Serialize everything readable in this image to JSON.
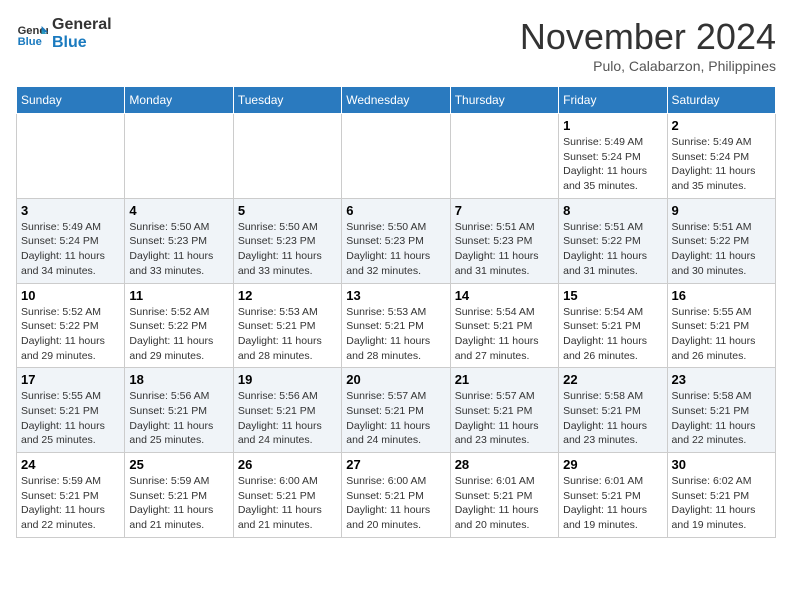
{
  "header": {
    "logo_line1": "General",
    "logo_line2": "Blue",
    "month": "November 2024",
    "location": "Pulo, Calabarzon, Philippines"
  },
  "weekdays": [
    "Sunday",
    "Monday",
    "Tuesday",
    "Wednesday",
    "Thursday",
    "Friday",
    "Saturday"
  ],
  "weeks": [
    [
      {
        "day": "",
        "info": ""
      },
      {
        "day": "",
        "info": ""
      },
      {
        "day": "",
        "info": ""
      },
      {
        "day": "",
        "info": ""
      },
      {
        "day": "",
        "info": ""
      },
      {
        "day": "1",
        "info": "Sunrise: 5:49 AM\nSunset: 5:24 PM\nDaylight: 11 hours and 35 minutes."
      },
      {
        "day": "2",
        "info": "Sunrise: 5:49 AM\nSunset: 5:24 PM\nDaylight: 11 hours and 35 minutes."
      }
    ],
    [
      {
        "day": "3",
        "info": "Sunrise: 5:49 AM\nSunset: 5:24 PM\nDaylight: 11 hours and 34 minutes."
      },
      {
        "day": "4",
        "info": "Sunrise: 5:50 AM\nSunset: 5:23 PM\nDaylight: 11 hours and 33 minutes."
      },
      {
        "day": "5",
        "info": "Sunrise: 5:50 AM\nSunset: 5:23 PM\nDaylight: 11 hours and 33 minutes."
      },
      {
        "day": "6",
        "info": "Sunrise: 5:50 AM\nSunset: 5:23 PM\nDaylight: 11 hours and 32 minutes."
      },
      {
        "day": "7",
        "info": "Sunrise: 5:51 AM\nSunset: 5:23 PM\nDaylight: 11 hours and 31 minutes."
      },
      {
        "day": "8",
        "info": "Sunrise: 5:51 AM\nSunset: 5:22 PM\nDaylight: 11 hours and 31 minutes."
      },
      {
        "day": "9",
        "info": "Sunrise: 5:51 AM\nSunset: 5:22 PM\nDaylight: 11 hours and 30 minutes."
      }
    ],
    [
      {
        "day": "10",
        "info": "Sunrise: 5:52 AM\nSunset: 5:22 PM\nDaylight: 11 hours and 29 minutes."
      },
      {
        "day": "11",
        "info": "Sunrise: 5:52 AM\nSunset: 5:22 PM\nDaylight: 11 hours and 29 minutes."
      },
      {
        "day": "12",
        "info": "Sunrise: 5:53 AM\nSunset: 5:21 PM\nDaylight: 11 hours and 28 minutes."
      },
      {
        "day": "13",
        "info": "Sunrise: 5:53 AM\nSunset: 5:21 PM\nDaylight: 11 hours and 28 minutes."
      },
      {
        "day": "14",
        "info": "Sunrise: 5:54 AM\nSunset: 5:21 PM\nDaylight: 11 hours and 27 minutes."
      },
      {
        "day": "15",
        "info": "Sunrise: 5:54 AM\nSunset: 5:21 PM\nDaylight: 11 hours and 26 minutes."
      },
      {
        "day": "16",
        "info": "Sunrise: 5:55 AM\nSunset: 5:21 PM\nDaylight: 11 hours and 26 minutes."
      }
    ],
    [
      {
        "day": "17",
        "info": "Sunrise: 5:55 AM\nSunset: 5:21 PM\nDaylight: 11 hours and 25 minutes."
      },
      {
        "day": "18",
        "info": "Sunrise: 5:56 AM\nSunset: 5:21 PM\nDaylight: 11 hours and 25 minutes."
      },
      {
        "day": "19",
        "info": "Sunrise: 5:56 AM\nSunset: 5:21 PM\nDaylight: 11 hours and 24 minutes."
      },
      {
        "day": "20",
        "info": "Sunrise: 5:57 AM\nSunset: 5:21 PM\nDaylight: 11 hours and 24 minutes."
      },
      {
        "day": "21",
        "info": "Sunrise: 5:57 AM\nSunset: 5:21 PM\nDaylight: 11 hours and 23 minutes."
      },
      {
        "day": "22",
        "info": "Sunrise: 5:58 AM\nSunset: 5:21 PM\nDaylight: 11 hours and 23 minutes."
      },
      {
        "day": "23",
        "info": "Sunrise: 5:58 AM\nSunset: 5:21 PM\nDaylight: 11 hours and 22 minutes."
      }
    ],
    [
      {
        "day": "24",
        "info": "Sunrise: 5:59 AM\nSunset: 5:21 PM\nDaylight: 11 hours and 22 minutes."
      },
      {
        "day": "25",
        "info": "Sunrise: 5:59 AM\nSunset: 5:21 PM\nDaylight: 11 hours and 21 minutes."
      },
      {
        "day": "26",
        "info": "Sunrise: 6:00 AM\nSunset: 5:21 PM\nDaylight: 11 hours and 21 minutes."
      },
      {
        "day": "27",
        "info": "Sunrise: 6:00 AM\nSunset: 5:21 PM\nDaylight: 11 hours and 20 minutes."
      },
      {
        "day": "28",
        "info": "Sunrise: 6:01 AM\nSunset: 5:21 PM\nDaylight: 11 hours and 20 minutes."
      },
      {
        "day": "29",
        "info": "Sunrise: 6:01 AM\nSunset: 5:21 PM\nDaylight: 11 hours and 19 minutes."
      },
      {
        "day": "30",
        "info": "Sunrise: 6:02 AM\nSunset: 5:21 PM\nDaylight: 11 hours and 19 minutes."
      }
    ]
  ]
}
